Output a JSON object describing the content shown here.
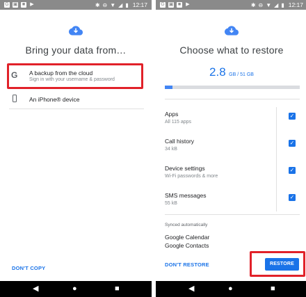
{
  "status_bar": {
    "time": "12:17"
  },
  "left": {
    "title": "Bring your data from…",
    "options": [
      {
        "label": "A backup from the cloud",
        "sub": "Sign in with your username & password",
        "icon": "google-g-icon",
        "glyph": "G"
      },
      {
        "label": "An iPhone® device",
        "sub": "",
        "icon": "phone-icon"
      }
    ],
    "dont_copy": "DON'T COPY"
  },
  "right": {
    "title": "Choose what to restore",
    "amount": {
      "value": "2.8",
      "unit": "GB / 51 GB",
      "fraction": 0.055
    },
    "items": [
      {
        "name": "Apps",
        "detail": "All 115 apps",
        "checked": true
      },
      {
        "name": "Call history",
        "detail": "34 kB",
        "checked": true
      },
      {
        "name": "Device settings",
        "detail": "Wi-Fi passwords & more",
        "checked": true
      },
      {
        "name": "SMS messages",
        "detail": "55 kB",
        "checked": true
      }
    ],
    "synced_heading": "Synced automatically",
    "synced": [
      "Google Calendar",
      "Google Contacts"
    ],
    "dont_restore": "DON'T RESTORE",
    "restore": "RESTORE"
  },
  "colors": {
    "accent": "#1a73e8",
    "highlight": "#e12129",
    "statusbar": "#8a8a8a",
    "navbar": "#000000"
  },
  "navbar": {
    "back": "◀",
    "home": "●",
    "recents": "■"
  }
}
